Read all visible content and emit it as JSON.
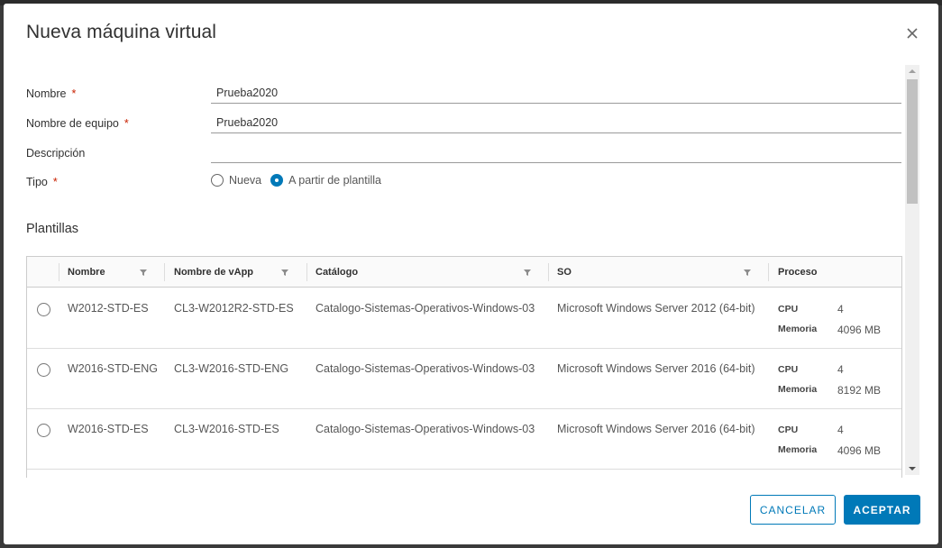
{
  "dialog": {
    "title": "Nueva máquina virtual",
    "close_icon": "close-icon"
  },
  "form": {
    "name_label": "Nombre",
    "name_value": "Prueba2020",
    "computer_name_label": "Nombre de equipo",
    "computer_name_value": "Prueba2020",
    "description_label": "Descripción",
    "description_value": "",
    "type_label": "Tipo",
    "type_options": [
      "Nueva",
      "A partir de plantilla"
    ],
    "type_selected": "A partir de plantilla",
    "required_mark": "*"
  },
  "templates": {
    "section_title": "Plantillas",
    "columns": [
      "Nombre",
      "Nombre de vApp",
      "Catálogo",
      "SO",
      "Proceso"
    ],
    "cpu_label": "CPU",
    "memory_label": "Memoria",
    "rows": [
      {
        "name": "W2012-STD-ES",
        "vapp": "CL3-W2012R2-STD-ES",
        "catalog": "Catalogo-Sistemas-Operativos-Windows-03",
        "os": "Microsoft Windows Server 2012 (64-bit)",
        "cpu": "4",
        "memory": "4096 MB"
      },
      {
        "name": "W2016-STD-ENG",
        "vapp": "CL3-W2016-STD-ENG",
        "catalog": "Catalogo-Sistemas-Operativos-Windows-03",
        "os": "Microsoft Windows Server 2016 (64-bit)",
        "cpu": "4",
        "memory": "8192 MB"
      },
      {
        "name": "W2016-STD-ES",
        "vapp": "CL3-W2016-STD-ES",
        "catalog": "Catalogo-Sistemas-Operativos-Windows-03",
        "os": "Microsoft Windows Server 2016 (64-bit)",
        "cpu": "4",
        "memory": "4096 MB"
      }
    ]
  },
  "footer": {
    "cancel_label": "CANCELAR",
    "accept_label": "ACEPTAR"
  },
  "colors": {
    "accent": "#0079b8",
    "required": "#c92100"
  }
}
